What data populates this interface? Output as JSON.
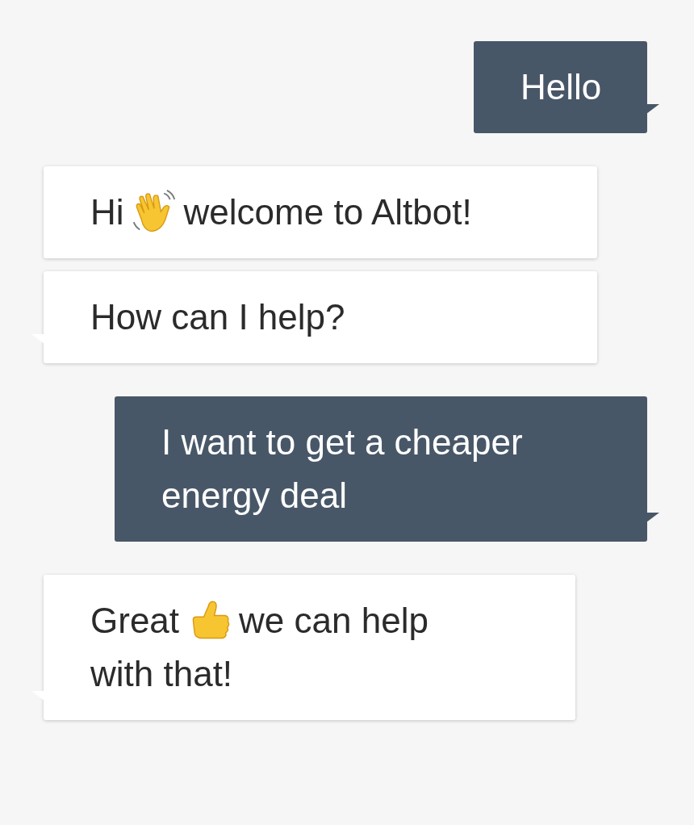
{
  "messages": [
    {
      "kind": "sent",
      "tail": true,
      "lines": [
        [
          {
            "kind": "text",
            "text": "Hello"
          }
        ]
      ]
    },
    {
      "kind": "received",
      "tail": false,
      "lines": [
        [
          {
            "kind": "text",
            "text": "Hi"
          },
          {
            "kind": "wave"
          },
          {
            "kind": "text",
            "text": "welcome to Altbot!"
          }
        ]
      ]
    },
    {
      "kind": "received",
      "tail": true,
      "lines": [
        [
          {
            "kind": "text",
            "text": "How can I help?"
          }
        ]
      ]
    },
    {
      "kind": "sent",
      "tail": true,
      "lines": [
        [
          {
            "kind": "text",
            "text": "I want to get a cheaper"
          }
        ],
        [
          {
            "kind": "text",
            "text": "energy deal"
          }
        ]
      ]
    },
    {
      "kind": "received",
      "tail": true,
      "lines": [
        [
          {
            "kind": "text",
            "text": "Great"
          },
          {
            "kind": "thumbs"
          },
          {
            "kind": "text",
            "text": "we can help"
          }
        ],
        [
          {
            "kind": "text",
            "text": "with that!"
          }
        ]
      ]
    }
  ]
}
